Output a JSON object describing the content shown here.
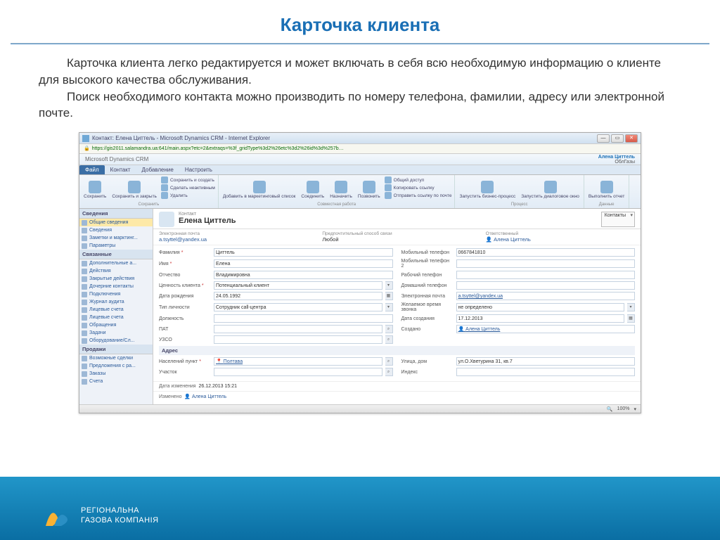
{
  "slide": {
    "title": "Карточка клиента",
    "para1": "Карточка  клиента легко редактируется и может включать  в себя всю необходимую информацию о клиенте для высокого качества обслуживания.",
    "para2": "Поиск необходимого контакта можно производить по номеру телефона, фамилии, адресу или электронной почте."
  },
  "window": {
    "title": "Контакт: Елена Циттель - Microsoft Dynamics CRM - Internet Explorer",
    "url": "https://gis2011.salamandra.ua:641/main.aspx?etc=2&extraqs=%3f_gridType%3d2%26etc%3d2%26id%3d%257b…",
    "brand": "Microsoft Dynamics CRM",
    "user_name": "Алена Циттель",
    "user_org": "ОблГазы",
    "zoom": "100%"
  },
  "ribbon": {
    "tabs": [
      "Файл",
      "Контакт",
      "Добавление",
      "Настроить"
    ],
    "g1_label": "Сохранить",
    "g1_btn1": "Сохранить",
    "g1_btn2": "Сохранить и закрыть",
    "g1_s1": "Сохранить и создать",
    "g1_s2": "Сделать неактивным",
    "g1_s3": "Удалить",
    "g2_label": "Совместная работа",
    "g2_btn1": "Добавить в маркетинговый список",
    "g2_btn2": "Соединить",
    "g2_btn3": "Назначить",
    "g2_btn4": "Позвонить",
    "g2_s1": "Общий доступ",
    "g2_s2": "Копировать ссылку",
    "g2_s3": "Отправить ссылку по почте",
    "g3_label": "Процесс",
    "g3_btn1": "Запустить бизнес-процесс",
    "g3_btn2": "Запустить диалоговое окно",
    "g4_label": "Данные",
    "g4_btn1": "Выполнить отчет"
  },
  "sidebar": {
    "h1": "Сведения",
    "h2": "Связанные",
    "h3": "Продажи",
    "items1": [
      "Общие сведения",
      "Сведения",
      "Заметки и марктинг...",
      "Параметры"
    ],
    "items2": [
      "Дополнительные а...",
      "Действия",
      "Закрытые действия",
      "Дочерние контакты",
      "Подключения",
      "Журнал аудита",
      "Лицевые счета",
      "Лицевые счета",
      "Обращения",
      "Задачи",
      "Оборудование/Сл..."
    ],
    "items3": [
      "Возможные сделки",
      "Предложения с ра...",
      "Заказы",
      "Счета"
    ]
  },
  "content": {
    "type_label": "Контакт",
    "name": "Елена Циттель",
    "dropdown": "Контакты",
    "summary": {
      "email_label": "Электронная почта",
      "email_val": "a.tsyttel@yandex.ua",
      "call_label": "Предпочтительный способ связи",
      "call_val": "Любой",
      "owner_label": "Ответственный",
      "owner_val": "Алена Циттель"
    },
    "fields": {
      "lastname_l": "Фамилия",
      "lastname_v": "Циттель",
      "mobile_l": "Мобильный телефон",
      "mobile_v": "0667841810",
      "firstname_l": "Имя",
      "firstname_v": "Елена",
      "mobile2_l": "Мобильный телефон 2",
      "mobile2_v": "",
      "patronymic_l": "Отчество",
      "patronymic_v": "Владимировна",
      "workphone_l": "Рабочий телефон",
      "workphone_v": "",
      "value_l": "Ценность клиента",
      "value_v": "Потенциальный клиент",
      "homephone_l": "Домашний телефон",
      "homephone_v": "",
      "dob_l": "Дата рождения",
      "dob_v": "24.05.1992",
      "email2_l": "Электронная почта",
      "email2_v": "a.tsyttel@yandex.ua",
      "type_l": "Тип личности",
      "type_v": "Сотрудник call-центра",
      "wish_l": "Желаемое время звонка",
      "wish_v": "не определено",
      "position_l": "Должность",
      "position_v": "",
      "created_l": "Дата создания",
      "created_v": "17.12.2013",
      "pat_l": "ПАТ",
      "pat_v": "",
      "createdby_l": "Создано",
      "createdby_v": "Алена Циттель",
      "uzso_l": "УЗСО",
      "uzso_v": ""
    },
    "address_section": "Адрес",
    "addr": {
      "city_l": "Населений пункт",
      "city_v": "Полтава",
      "street_l": "Улица, дом",
      "street_v": "ул.О.Хветурина 31, кв.7",
      "uchastok_l": "Участок",
      "uchastok_v": "",
      "index_l": "Индекс",
      "index_v": ""
    },
    "meta": {
      "modified_l": "Дата изменения",
      "modified_v": "26.12.2013 15:21",
      "changedby_l": "Изменено",
      "changedby_v": "Алена Циттель"
    }
  },
  "footer": {
    "line1": "РЕГІОНАЛЬНА",
    "line2": "ГАЗОВА КОМПАНІЯ"
  }
}
